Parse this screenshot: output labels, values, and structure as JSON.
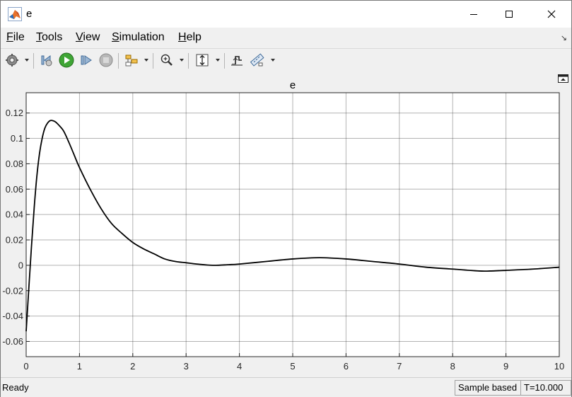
{
  "window": {
    "title": "e"
  },
  "menu": {
    "items": [
      {
        "key": "F",
        "rest": "ile"
      },
      {
        "key": "T",
        "rest": "ools"
      },
      {
        "key": "V",
        "rest": "iew"
      },
      {
        "key": "S",
        "rest": "imulation"
      },
      {
        "key": "H",
        "rest": "elp"
      }
    ]
  },
  "toolbar": {
    "icons": [
      "settings-icon",
      "step-back-icon",
      "run-icon",
      "step-forward-icon",
      "stop-icon",
      "highlight-block-icon",
      "zoom-icon",
      "autoscale-icon",
      "triggers-icon",
      "measurements-icon"
    ]
  },
  "status": {
    "left": "Ready",
    "mode": "Sample based",
    "time": "T=10.000"
  },
  "colors": {
    "line": "#000000",
    "grid": "#262626",
    "axes_bg": "#ffffff",
    "figure_bg": "#f0f0f0",
    "matlab_orange": "#e8722a"
  },
  "chart_data": {
    "type": "line",
    "title": "e",
    "xlabel": "",
    "ylabel": "",
    "xlim": [
      0,
      10
    ],
    "ylim": [
      -0.072,
      0.136
    ],
    "xticks": [
      "0",
      "1",
      "2",
      "3",
      "4",
      "5",
      "6",
      "7",
      "8",
      "9",
      "10"
    ],
    "yticks": [
      "-0.06",
      "-0.04",
      "-0.02",
      "0",
      "0.02",
      "0.04",
      "0.06",
      "0.08",
      "0.1",
      "0.12"
    ],
    "grid": true,
    "series": [
      {
        "x": [
          0,
          0.05,
          0.1,
          0.15,
          0.2,
          0.25,
          0.3,
          0.35,
          0.4,
          0.45,
          0.5,
          0.55,
          0.6,
          0.7,
          0.8,
          0.9,
          1.0,
          1.2,
          1.4,
          1.6,
          1.8,
          2.0,
          2.2,
          2.4,
          2.6,
          2.8,
          3.0,
          3.2,
          3.5,
          3.8,
          4.0,
          4.5,
          5.0,
          5.5,
          6.0,
          6.5,
          7.0,
          7.5,
          8.0,
          8.5,
          8.7,
          9.0,
          9.5,
          10.0
        ],
        "y": [
          -0.052,
          -0.018,
          0.015,
          0.045,
          0.07,
          0.088,
          0.1,
          0.108,
          0.112,
          0.114,
          0.114,
          0.113,
          0.111,
          0.106,
          0.097,
          0.087,
          0.077,
          0.06,
          0.045,
          0.033,
          0.025,
          0.018,
          0.013,
          0.009,
          0.005,
          0.003,
          0.002,
          0.001,
          0.0,
          0.0005,
          0.001,
          0.003,
          0.005,
          0.006,
          0.005,
          0.003,
          0.001,
          -0.0015,
          -0.003,
          -0.0045,
          -0.0045,
          -0.004,
          -0.003,
          -0.0015
        ]
      }
    ]
  }
}
